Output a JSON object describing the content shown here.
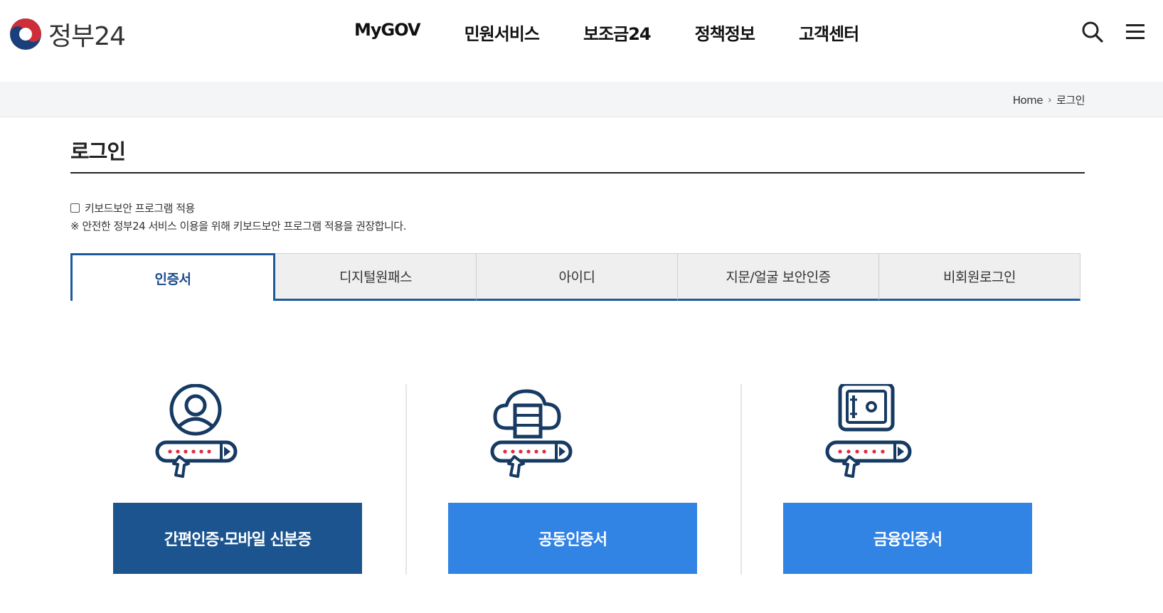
{
  "header": {
    "logo_text": "정부24",
    "nav": [
      "MyGOV",
      "민원서비스",
      "보조금24",
      "정책정보",
      "고객센터"
    ]
  },
  "breadcrumb": {
    "home": "Home",
    "current": "로그인"
  },
  "page": {
    "title": "로그인",
    "keyboard_security_label": "키보드보안 프로그램 적용",
    "keyboard_security_note": "※ 안전한 정부24 서비스 이용을 위해 키보드보안 프로그램 적용을 권장합니다."
  },
  "tabs": [
    "인증서",
    "디지털원패스",
    "아이디",
    "지문/얼굴 보안인증",
    "비회원로그인"
  ],
  "cards": [
    {
      "label": "간편인증·모바일 신분증",
      "icon": "user-certificate-icon",
      "color": "#1b548e"
    },
    {
      "label": "공동인증서",
      "icon": "cloud-server-certificate-icon",
      "color": "#3183e4"
    },
    {
      "label": "금융인증서",
      "icon": "safe-certificate-icon",
      "color": "#3183e4"
    }
  ],
  "colors": {
    "primary": "#1d5a9c",
    "accent": "#3183e4",
    "dark_blue": "#1b548e",
    "red_dots": "#e5263b"
  }
}
